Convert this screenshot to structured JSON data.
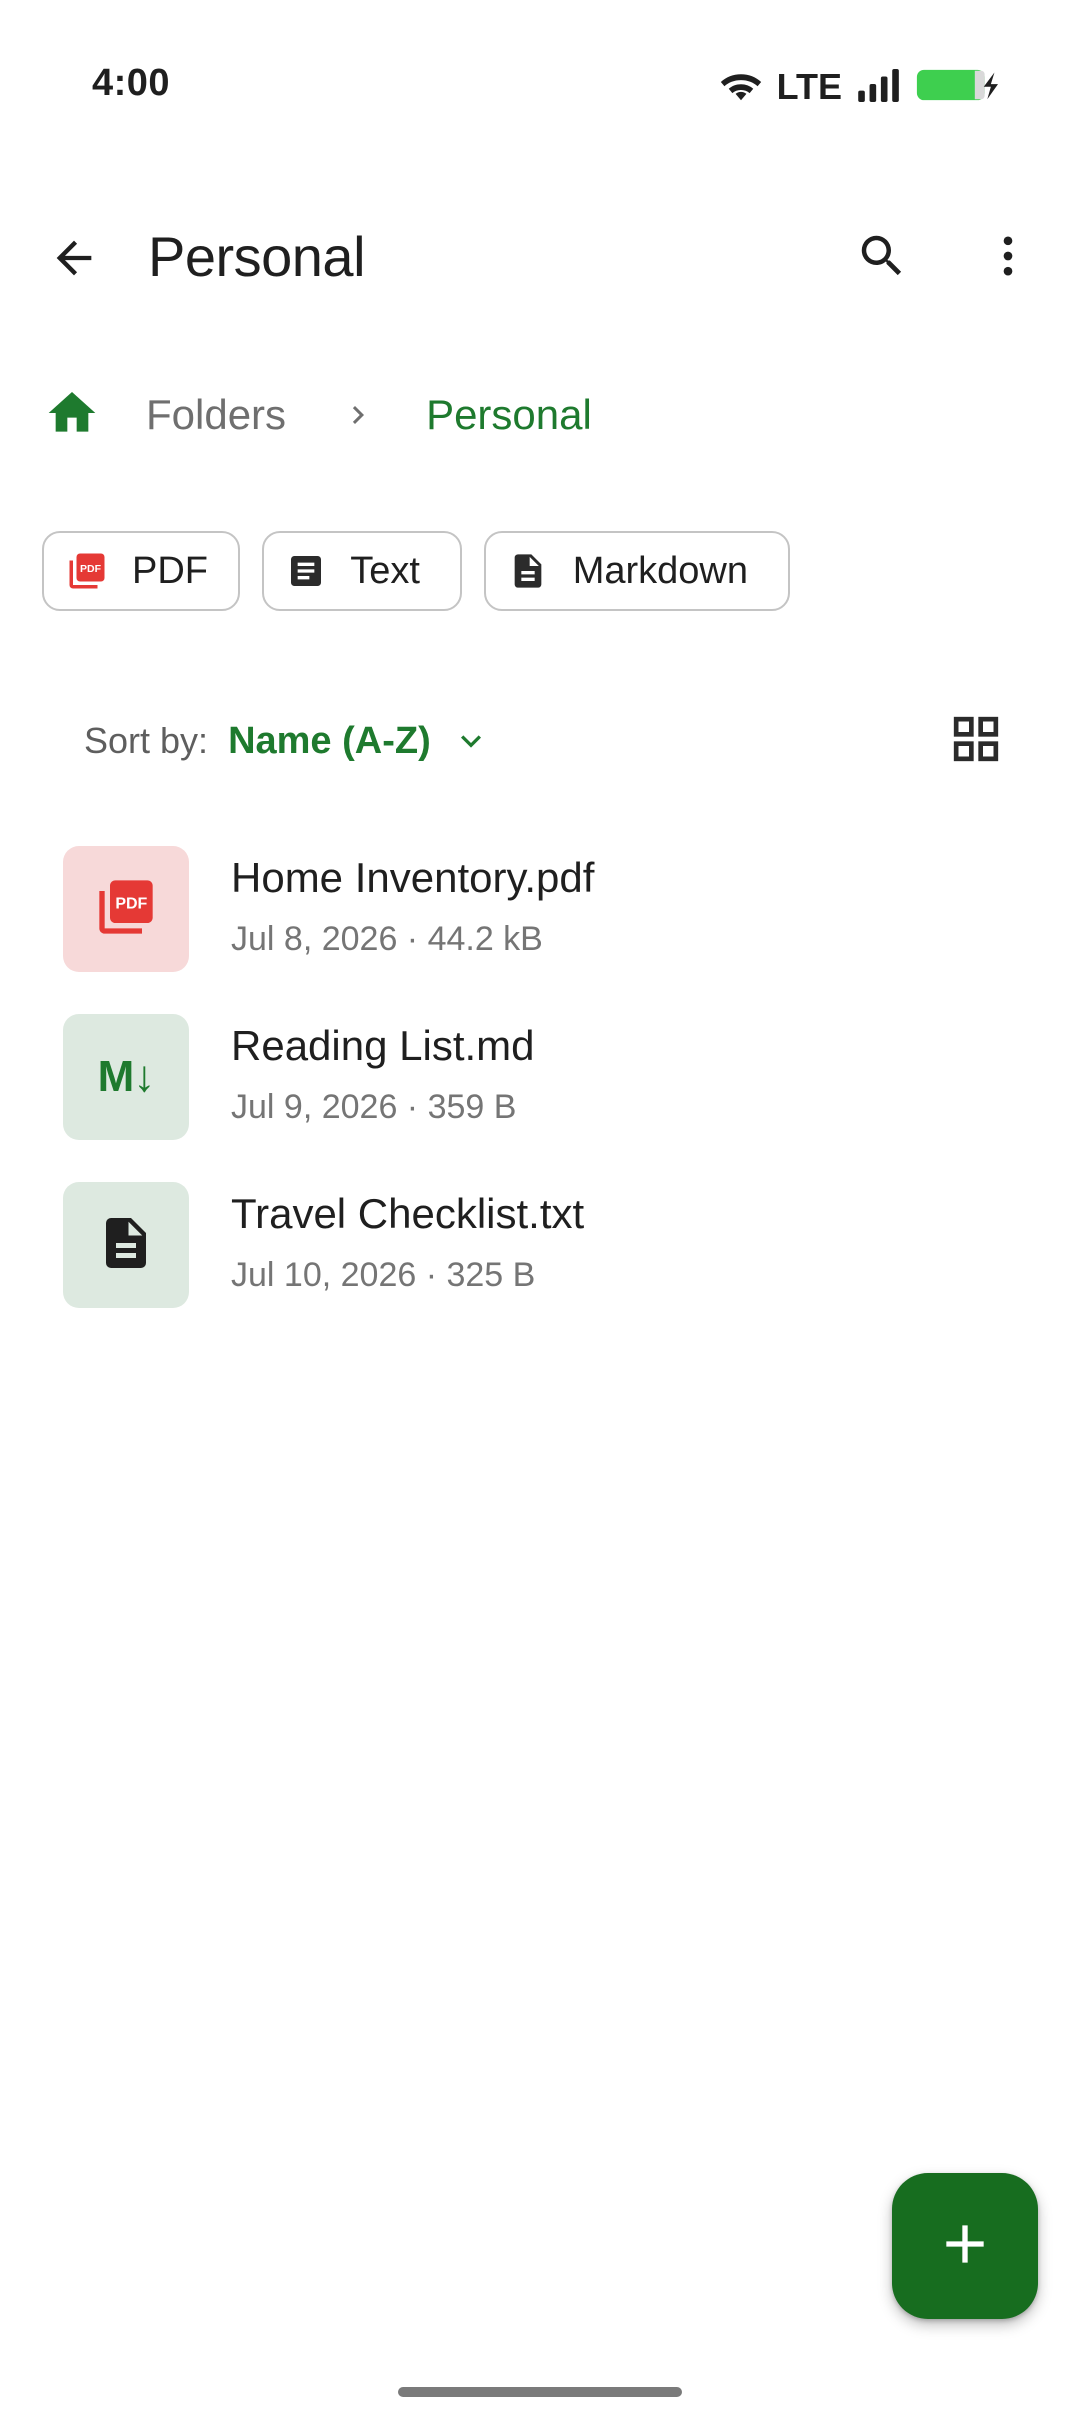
{
  "status_bar": {
    "time": "4:00",
    "network": "LTE",
    "icons": [
      "wifi-icon",
      "signal-icon",
      "battery-charging-icon"
    ]
  },
  "app_bar": {
    "title": "Personal",
    "back_icon": "arrow-back-icon",
    "search_icon": "search-icon",
    "more_icon": "more-vert-icon"
  },
  "breadcrumb": {
    "home_icon": "home-icon",
    "items": [
      {
        "label": "Folders"
      },
      {
        "label": "Personal"
      }
    ],
    "separator_icon": "chevron-right-icon"
  },
  "filters": [
    {
      "label": "PDF",
      "icon": "pdf-icon"
    },
    {
      "label": "Text",
      "icon": "text-document-icon"
    },
    {
      "label": "Markdown",
      "icon": "file-document-icon"
    }
  ],
  "sort": {
    "caption": "Sort by:",
    "value": "Name (A-Z)",
    "chevron_icon": "chevron-down-icon",
    "view_toggle_icon": "grid-view-icon"
  },
  "files": [
    {
      "name": "Home Inventory.pdf",
      "meta": "Jul 8, 2026 · 44.2 kB",
      "type": "pdf"
    },
    {
      "name": "Reading List.md",
      "meta": "Jul 9, 2026 · 359 B",
      "type": "md",
      "glyph": "M↓"
    },
    {
      "name": "Travel Checklist.txt",
      "meta": "Jul 10, 2026 · 325 B",
      "type": "txt"
    }
  ],
  "fab": {
    "icon": "add-icon"
  },
  "colors": {
    "accent": "#1e7a2e",
    "fab": "#176d1f",
    "pdf_red": "#e53935",
    "pdf_thumb_bg": "#f7d9d9",
    "green_thumb_bg": "#dde9e0"
  }
}
